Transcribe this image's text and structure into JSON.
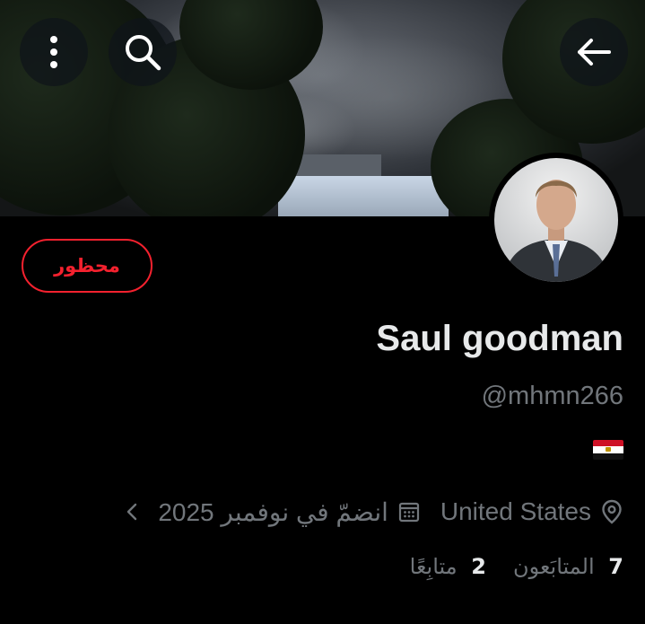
{
  "header": {
    "back_icon": "arrow-left-icon",
    "search_icon": "search-icon",
    "more_icon": "more-vertical-icon"
  },
  "profile": {
    "blocked_label": "محظور",
    "display_name": "Saul goodman",
    "handle": "@mhmn266",
    "bio_flag": "egypt-flag",
    "location": "United States",
    "joined": "انضمّ في نوفمبر 2025",
    "following_count": "2",
    "following_label": "متابِعًا",
    "followers_count": "7",
    "followers_label": "المتابَعون"
  },
  "colors": {
    "background": "#000000",
    "blocked_red": "#f4212e",
    "primary_text": "#e7e9ea",
    "secondary_text": "#71767b"
  }
}
